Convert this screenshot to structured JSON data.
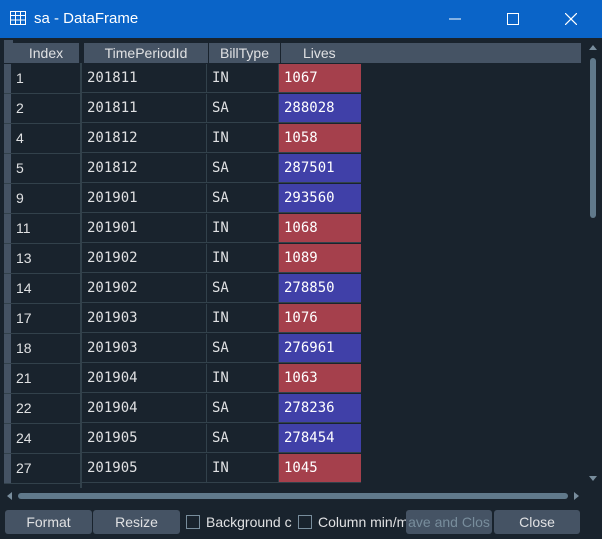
{
  "window": {
    "title": "sa - DataFrame",
    "icon": "table-icon"
  },
  "colors": {
    "in_cell": "#a5404c",
    "sa_cell": "#4040a8",
    "header_bg": "#455364",
    "bg": "#19232d"
  },
  "table": {
    "index_header": "Index",
    "columns": [
      "TimePeriodId",
      "BillType",
      "Lives"
    ],
    "rows": [
      {
        "index": "1",
        "period": "201811",
        "bill": "IN",
        "lives": "1067"
      },
      {
        "index": "2",
        "period": "201811",
        "bill": "SA",
        "lives": "288028"
      },
      {
        "index": "4",
        "period": "201812",
        "bill": "IN",
        "lives": "1058"
      },
      {
        "index": "5",
        "period": "201812",
        "bill": "SA",
        "lives": "287501"
      },
      {
        "index": "9",
        "period": "201901",
        "bill": "SA",
        "lives": "293560"
      },
      {
        "index": "11",
        "period": "201901",
        "bill": "IN",
        "lives": "1068"
      },
      {
        "index": "13",
        "period": "201902",
        "bill": "IN",
        "lives": "1089"
      },
      {
        "index": "14",
        "period": "201902",
        "bill": "SA",
        "lives": "278850"
      },
      {
        "index": "17",
        "period": "201903",
        "bill": "IN",
        "lives": "1076"
      },
      {
        "index": "18",
        "period": "201903",
        "bill": "SA",
        "lives": "276961"
      },
      {
        "index": "21",
        "period": "201904",
        "bill": "IN",
        "lives": "1063"
      },
      {
        "index": "22",
        "period": "201904",
        "bill": "SA",
        "lives": "278236"
      },
      {
        "index": "24",
        "period": "201905",
        "bill": "SA",
        "lives": "278454"
      },
      {
        "index": "27",
        "period": "201905",
        "bill": "IN",
        "lives": "1045"
      }
    ]
  },
  "buttons": {
    "format": "Format",
    "resize": "Resize",
    "background": "Background co",
    "column_minmax": "Column min/m",
    "save_close": "ave and Clos",
    "close": "Close"
  }
}
